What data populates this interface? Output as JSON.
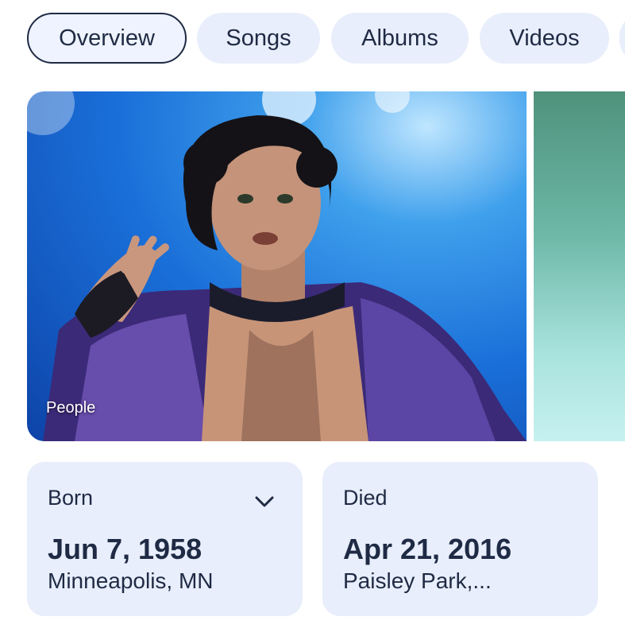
{
  "tabs": [
    {
      "label": "Overview",
      "active": true
    },
    {
      "label": "Songs",
      "active": false
    },
    {
      "label": "Albums",
      "active": false
    },
    {
      "label": "Videos",
      "active": false
    }
  ],
  "image_carousel": {
    "main_image_caption": "People"
  },
  "born": {
    "label": "Born",
    "date": "Jun 7, 1958",
    "place": "Minneapolis, MN",
    "expand_icon": "chevron-down-icon"
  },
  "died": {
    "label": "Died",
    "date": "Apr 21, 2016",
    "place": "Paisley Park,..."
  },
  "colors": {
    "chip_bg": "#e8eefb",
    "text": "#1f2a44",
    "card_bg": "#e8eefb"
  }
}
